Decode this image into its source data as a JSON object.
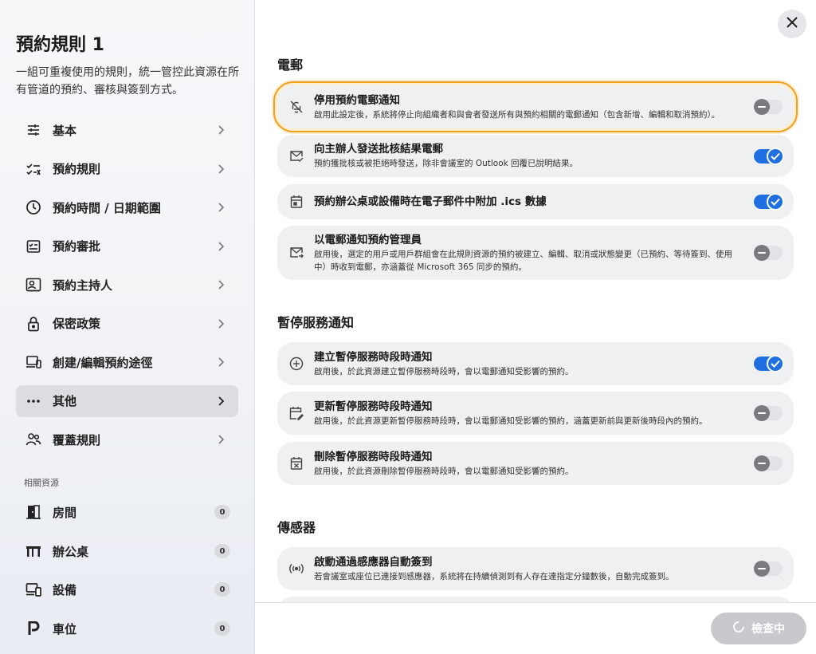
{
  "sidebar": {
    "title": "預約規則 1",
    "description": "一組可重複使用的規則，統一管控此資源在所有管道的預約、審核與簽到方式。",
    "items": [
      {
        "label": "基本",
        "icon": "sliders-icon"
      },
      {
        "label": "預約規則",
        "icon": "checklist-icon"
      },
      {
        "label": "預約時間 / 日期範圍",
        "icon": "clock-icon"
      },
      {
        "label": "預約審批",
        "icon": "approval-icon"
      },
      {
        "label": "預約主持人",
        "icon": "host-icon"
      },
      {
        "label": "保密政策",
        "icon": "lock-icon"
      },
      {
        "label": "創建/編輯預約途徑",
        "icon": "devices-icon"
      },
      {
        "label": "其他",
        "icon": "more-icon",
        "active": true
      },
      {
        "label": "覆蓋規則",
        "icon": "people-icon"
      }
    ],
    "resources_label": "相關資源",
    "resources": [
      {
        "label": "房間",
        "count": "0",
        "icon": "door-icon"
      },
      {
        "label": "辦公桌",
        "count": "0",
        "icon": "desk-icon"
      },
      {
        "label": "設備",
        "count": "0",
        "icon": "device-icon"
      },
      {
        "label": "車位",
        "count": "0",
        "icon": "parking-icon"
      }
    ]
  },
  "main": {
    "sections": [
      {
        "heading": "電郵",
        "cards": [
          {
            "title": "停用預約電郵通知",
            "sub": "啟用此設定後，系統將停止向組織者和與會者發送所有與預約相關的電郵通知（包含新增、編輯和取消預約）。",
            "toggle": false,
            "icon": "bell-off-icon"
          },
          {
            "title": "向主辦人發送批核結果電郵",
            "sub": "預約獲批核或被拒絕時發送，除非會議室的 Outlook 回覆已說明結果。",
            "toggle": true,
            "icon": "mail-check-icon"
          },
          {
            "title": "預約辦公桌或設備時在電子郵件中附加 .ics 數據",
            "sub": "",
            "toggle": true,
            "icon": "calendar-icon"
          },
          {
            "title": "以電郵通知預約管理員",
            "sub": "啟用後，選定的用戶或用戶群組會在此規則資源的預約被建立、編輯、取消或狀態變更（已預約、等待簽到、使用中）時收到電郵，亦涵蓋從 Microsoft 365 同步的預約。",
            "toggle": false,
            "icon": "mail-forward-icon"
          }
        ]
      },
      {
        "heading": "暫停服務通知",
        "cards": [
          {
            "title": "建立暫停服務時段時通知",
            "sub": "啟用後，於此資源建立暫停服務時段時，會以電郵通知受影響的預約。",
            "toggle": true,
            "icon": "plus-circle-icon"
          },
          {
            "title": "更新暫停服務時段時通知",
            "sub": "啟用後，於此資源更新暫停服務時段時，會以電郵通知受影響的預約，涵蓋更新前與更新後時段內的預約。",
            "toggle": false,
            "icon": "calendar-edit-icon"
          },
          {
            "title": "刪除暫停服務時段時通知",
            "sub": "啟用後，於此資源刪除暫停服務時段時，會以電郵通知受影響的預約。",
            "toggle": false,
            "icon": "calendar-x-icon"
          }
        ]
      },
      {
        "heading": "傳感器",
        "cards": [
          {
            "title": "啟動通過感應器自動簽到",
            "sub": "若會議室或座位已連接到感應器，系統將在持續偵測到有人存在達指定分鐘數後，自動完成簽到。",
            "toggle": false,
            "icon": "sensor-icon"
          }
        ]
      }
    ]
  },
  "footer": {
    "check_label": "檢查中"
  }
}
